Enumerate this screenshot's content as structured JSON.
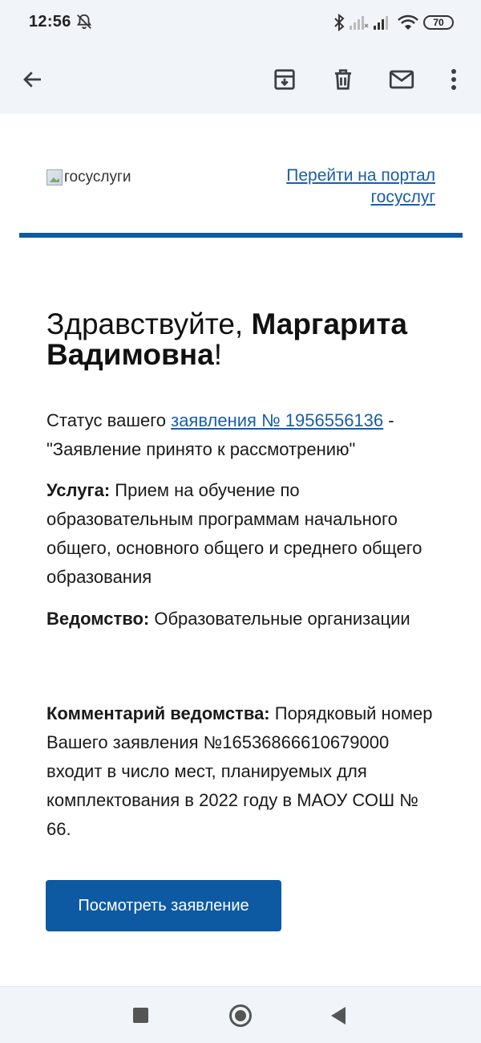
{
  "status_bar": {
    "time": "12:56",
    "battery": "70",
    "icons": [
      "bell-off-icon",
      "bluetooth-icon",
      "signal-icon",
      "signal-icon",
      "wifi-icon",
      "battery-icon"
    ]
  },
  "app_bar": {
    "icons": [
      "back-arrow-icon",
      "archive-icon",
      "delete-icon",
      "mark-unread-icon",
      "more-vert-icon"
    ]
  },
  "email": {
    "logo_alt": "госуслуги",
    "portal_link_line1": "Перейти на портал",
    "portal_link_line2": "госуслуг",
    "greeting_prefix": "Здравствуйте, ",
    "greeting_name": "Маргарита Вадимовна",
    "greeting_suffix": "!",
    "status_prefix": "Статус вашего ",
    "status_link": "заявления № 1956556136",
    "status_suffix": " - \"Заявление принято к рассмотрению\"",
    "service_label": "Услуга:",
    "service_value": " Прием на обучение по образовательным программам начального общего, основного общего и среднего общего образования",
    "agency_label": "Ведомство:",
    "agency_value": " Образовательные организации",
    "comment_label": "Комментарий ведомства:",
    "comment_value": " Порядковый номер Вашего заявления №16536866610679000 входит в число мест, планируемых для комплектования в 2022 году в МАОУ СОШ № 66.",
    "view_button": "Посмотреть заявление",
    "accent_color": "#0d5aa3",
    "link_color": "#1a5ea8"
  },
  "nav_bar": {
    "icons": [
      "recents-icon",
      "home-icon",
      "back-icon"
    ]
  }
}
